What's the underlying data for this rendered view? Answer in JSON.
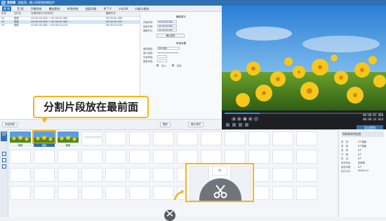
{
  "app": {
    "name": "爱剪辑",
    "subtitle": "超级简，最火的视频剪辑软件"
  },
  "menu_tabs": [
    "视 频",
    "音 频",
    "字幕特效",
    "叠加素材",
    "转场特效",
    "画面风格",
    "M T V",
    "卡拉OK",
    "升级与服务"
  ],
  "clip_table": {
    "headers": [
      "序号",
      "文件名",
      "在最终影片中的时间",
      "截取时长"
    ],
    "rows": [
      [
        "01",
        "视频",
        "00:00:00.000 → 00:00:00.480",
        "00:00:00.480"
      ],
      [
        "02",
        "视频",
        "00:00:00.480 → 00:00:00.480",
        "00:00:00.000"
      ],
      [
        "03",
        "视频",
        "00:00:00.480 → 00:00:24.014",
        "00:00:23.534"
      ]
    ]
  },
  "settings": {
    "cut_title": "截取原片",
    "start_label": "开始时间：",
    "start_value": "00:00:00.480",
    "end_label": "结束时间：",
    "end_value": "00:00:00.480",
    "duration_label": "截取时长：",
    "duration_value": "00:00:00.000",
    "confirm_label": "确认修改",
    "sound_title": "声音设置",
    "usage_label": "使用音轨：",
    "usage_value": "原片音轨",
    "vol_label": "原片音量：",
    "head_label": "头部声音：",
    "tail_label": "尾部声音：",
    "fade_in": "淡入",
    "fade_out": "淡出"
  },
  "list_toolbar": {
    "add_label": "添加视频",
    "delete_label": "删除",
    "confirm_label": "确认修改"
  },
  "player": {
    "current_time": "00:00:05.480",
    "total_time": "00:00:24.014"
  },
  "timeline": {
    "left_rail_label": "已添加片段",
    "clips": [
      {
        "label": "视频",
        "selected": false
      },
      {
        "label": "视频",
        "selected": true
      },
      {
        "label": "视频",
        "selected": false
      }
    ],
    "add_hint": "双击此处添加视频"
  },
  "props": {
    "title": "所有制作的信息",
    "rows": [
      {
        "k": "类　型：",
        "v": "3个视频"
      },
      {
        "k": "视　频：",
        "v": "3个视频"
      },
      {
        "k": "音　频：",
        "v": "0个"
      },
      {
        "k": "字　幕：",
        "v": "0个"
      },
      {
        "k": "叠　加：",
        "v": "0个"
      },
      {
        "k": "转场特效：",
        "v": "无转场"
      },
      {
        "k": "画面风格：",
        "v": "0个"
      },
      {
        "k": "影片时长：",
        "v": "00:00:24"
      }
    ]
  },
  "export_label": "导出视频",
  "callout_text": "分割片段放在最前面",
  "colors": {
    "accent": "#2f6fb4",
    "highlight": "#f2b51b"
  }
}
